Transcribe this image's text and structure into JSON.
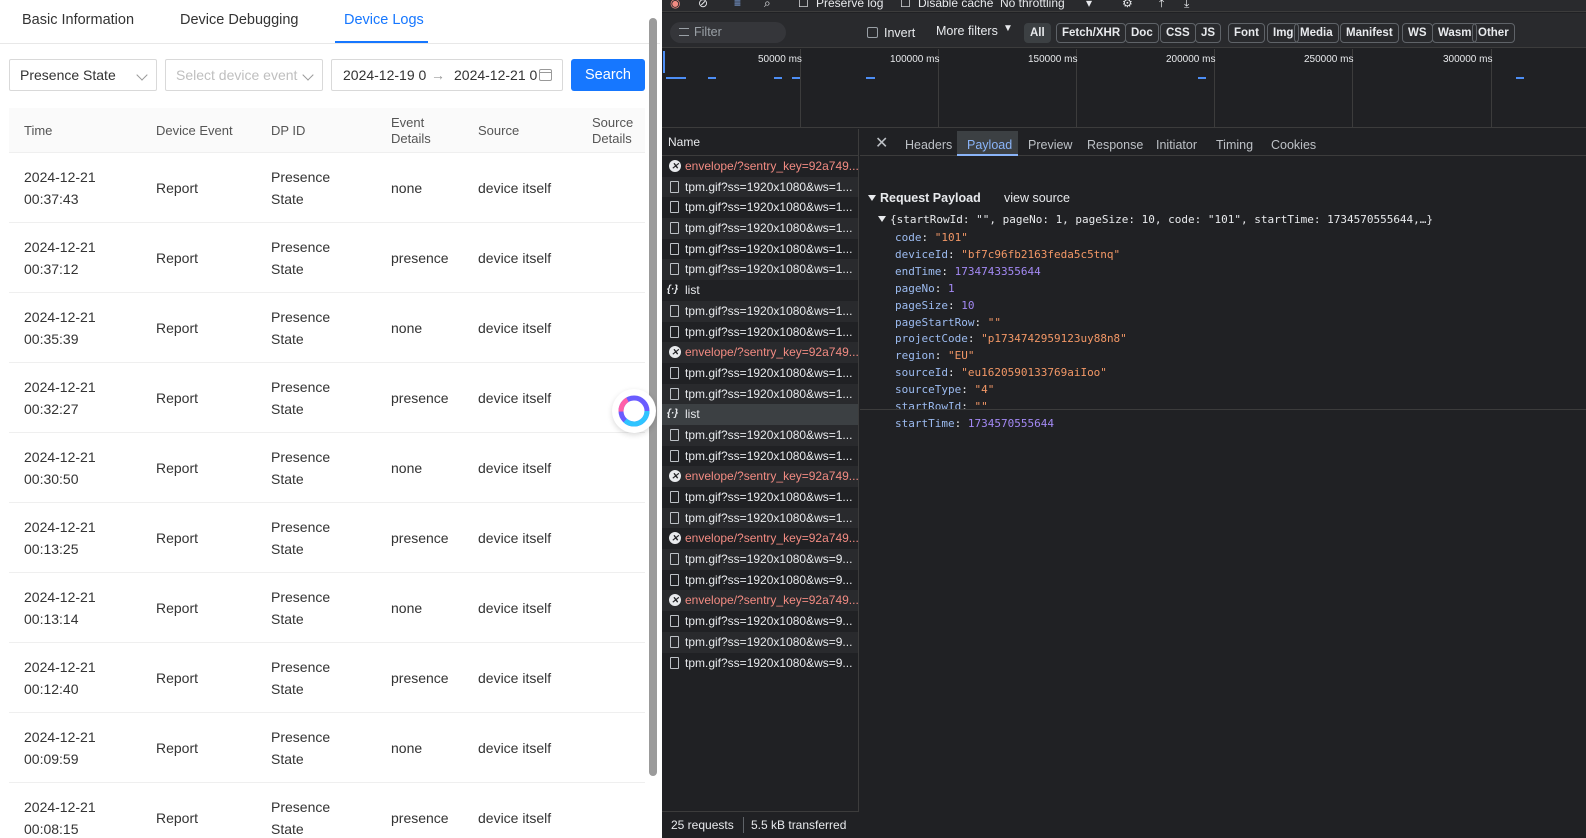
{
  "app": {
    "tabs": [
      "Basic Information",
      "Device Debugging",
      "Device Logs"
    ],
    "active_tab": "Device Logs",
    "filters": {
      "dp_select": "Presence State",
      "event_placeholder": "Select device event",
      "date_start": "2024-12-19 0",
      "date_arrow": "→",
      "date_end": "2024-12-21 0",
      "search_label": "Search"
    },
    "columns": [
      "Time",
      "Device Event",
      "DP ID",
      "Event Details",
      "Source",
      "Source Details"
    ],
    "rows": [
      {
        "date": "2024-12-21",
        "time": "00:37:43",
        "event": "Report",
        "dp1": "Presence",
        "dp2": "State",
        "details": "none",
        "source": "device itself"
      },
      {
        "date": "2024-12-21",
        "time": "00:37:12",
        "event": "Report",
        "dp1": "Presence",
        "dp2": "State",
        "details": "presence",
        "source": "device itself"
      },
      {
        "date": "2024-12-21",
        "time": "00:35:39",
        "event": "Report",
        "dp1": "Presence",
        "dp2": "State",
        "details": "none",
        "source": "device itself"
      },
      {
        "date": "2024-12-21",
        "time": "00:32:27",
        "event": "Report",
        "dp1": "Presence",
        "dp2": "State",
        "details": "presence",
        "source": "device itself"
      },
      {
        "date": "2024-12-21",
        "time": "00:30:50",
        "event": "Report",
        "dp1": "Presence",
        "dp2": "State",
        "details": "none",
        "source": "device itself"
      },
      {
        "date": "2024-12-21",
        "time": "00:13:25",
        "event": "Report",
        "dp1": "Presence",
        "dp2": "State",
        "details": "presence",
        "source": "device itself"
      },
      {
        "date": "2024-12-21",
        "time": "00:13:14",
        "event": "Report",
        "dp1": "Presence",
        "dp2": "State",
        "details": "none",
        "source": "device itself"
      },
      {
        "date": "2024-12-21",
        "time": "00:12:40",
        "event": "Report",
        "dp1": "Presence",
        "dp2": "State",
        "details": "presence",
        "source": "device itself"
      },
      {
        "date": "2024-12-21",
        "time": "00:09:59",
        "event": "Report",
        "dp1": "Presence",
        "dp2": "State",
        "details": "none",
        "source": "device itself"
      },
      {
        "date": "2024-12-21",
        "time": "00:08:15",
        "event": "Report",
        "dp1": "Presence",
        "dp2": "State",
        "details": "presence",
        "source": "device itself"
      }
    ]
  },
  "devtools": {
    "top_bar": {
      "preserve_log": "Preserve log",
      "disable_cache": "Disable cache",
      "throttling": "No throttling"
    },
    "filter_placeholder": "Filter",
    "invert_label": "Invert",
    "more_filters": "More filters",
    "type_chips": [
      "All",
      "Fetch/XHR",
      "Doc",
      "CSS",
      "JS",
      "Font",
      "Img",
      "Media",
      "Manifest",
      "WS",
      "Wasm",
      "Other"
    ],
    "timeline_labels": [
      "50000 ms",
      "100000 ms",
      "150000 ms",
      "200000 ms",
      "250000 ms",
      "300000 ms"
    ],
    "name_header": "Name",
    "requests": [
      {
        "name": "envelope/?sentry_key=92a749...",
        "kind": "error"
      },
      {
        "name": "tpm.gif?ss=1920x1080&ws=1...",
        "kind": "file"
      },
      {
        "name": "tpm.gif?ss=1920x1080&ws=1...",
        "kind": "file"
      },
      {
        "name": "tpm.gif?ss=1920x1080&ws=1...",
        "kind": "file"
      },
      {
        "name": "tpm.gif?ss=1920x1080&ws=1...",
        "kind": "file"
      },
      {
        "name": "tpm.gif?ss=1920x1080&ws=1...",
        "kind": "file"
      },
      {
        "name": "list",
        "kind": "xhr"
      },
      {
        "name": "tpm.gif?ss=1920x1080&ws=1...",
        "kind": "file"
      },
      {
        "name": "tpm.gif?ss=1920x1080&ws=1...",
        "kind": "file"
      },
      {
        "name": "envelope/?sentry_key=92a749...",
        "kind": "error"
      },
      {
        "name": "tpm.gif?ss=1920x1080&ws=1...",
        "kind": "file"
      },
      {
        "name": "tpm.gif?ss=1920x1080&ws=1...",
        "kind": "file"
      },
      {
        "name": "list",
        "kind": "xhr-selected"
      },
      {
        "name": "tpm.gif?ss=1920x1080&ws=1...",
        "kind": "file"
      },
      {
        "name": "tpm.gif?ss=1920x1080&ws=1...",
        "kind": "file"
      },
      {
        "name": "envelope/?sentry_key=92a749...",
        "kind": "error"
      },
      {
        "name": "tpm.gif?ss=1920x1080&ws=1...",
        "kind": "file"
      },
      {
        "name": "tpm.gif?ss=1920x1080&ws=1...",
        "kind": "file"
      },
      {
        "name": "envelope/?sentry_key=92a749...",
        "kind": "error"
      },
      {
        "name": "tpm.gif?ss=1920x1080&ws=9...",
        "kind": "file"
      },
      {
        "name": "tpm.gif?ss=1920x1080&ws=9...",
        "kind": "file"
      },
      {
        "name": "envelope/?sentry_key=92a749...",
        "kind": "error"
      },
      {
        "name": "tpm.gif?ss=1920x1080&ws=9...",
        "kind": "file"
      },
      {
        "name": "tpm.gif?ss=1920x1080&ws=9...",
        "kind": "file"
      },
      {
        "name": "tpm.gif?ss=1920x1080&ws=9...",
        "kind": "file"
      }
    ],
    "footer": {
      "requests": "25 requests",
      "transferred": "5.5 kB transferred"
    },
    "detail_tabs": [
      "Headers",
      "Payload",
      "Preview",
      "Response",
      "Initiator",
      "Timing",
      "Cookies"
    ],
    "active_detail_tab": "Payload",
    "payload": {
      "section_title": "Request Payload",
      "view_source": "view source",
      "summary": "{startRowId: \"\", pageNo: 1, pageSize: 10, code: \"101\", startTime: 1734570555644,…}",
      "fields": [
        {
          "key": "code",
          "value": "\"101\"",
          "type": "string"
        },
        {
          "key": "deviceId",
          "value": "\"bf7c96fb2163feda5c5tnq\"",
          "type": "string"
        },
        {
          "key": "endTime",
          "value": "1734743355644",
          "type": "number"
        },
        {
          "key": "pageNo",
          "value": "1",
          "type": "number"
        },
        {
          "key": "pageSize",
          "value": "10",
          "type": "number"
        },
        {
          "key": "pageStartRow",
          "value": "\"\"",
          "type": "string"
        },
        {
          "key": "projectCode",
          "value": "\"p1734742959123uy88n8\"",
          "type": "string"
        },
        {
          "key": "region",
          "value": "\"EU\"",
          "type": "string"
        },
        {
          "key": "sourceId",
          "value": "\"eu1620590133769aiIoo\"",
          "type": "string"
        },
        {
          "key": "sourceType",
          "value": "\"4\"",
          "type": "string"
        },
        {
          "key": "startRowId",
          "value": "\"\"",
          "type": "string"
        },
        {
          "key": "startTime",
          "value": "1734570555644",
          "type": "number"
        }
      ]
    }
  }
}
